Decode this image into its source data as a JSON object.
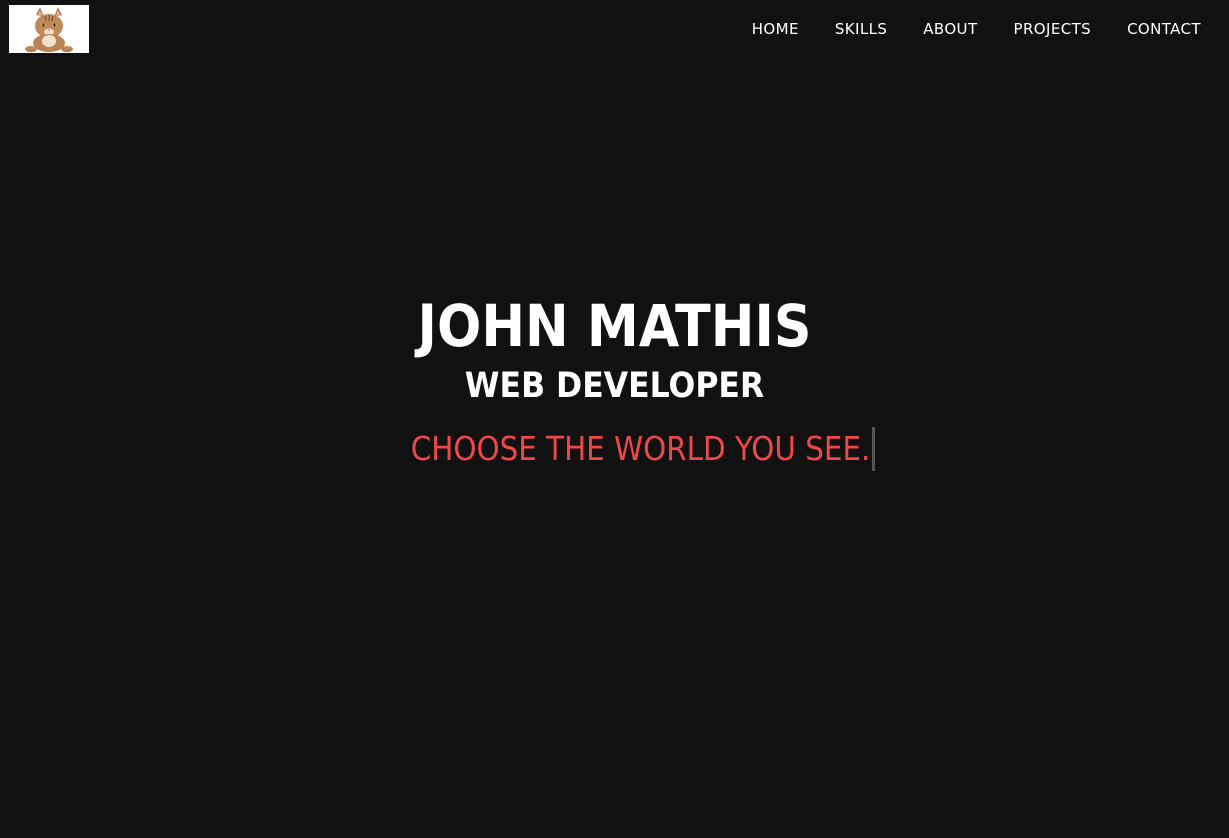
{
  "header": {
    "logo_icon": "cat-photo-logo",
    "nav": [
      {
        "label": "HOME"
      },
      {
        "label": "SKILLS"
      },
      {
        "label": "ABOUT"
      },
      {
        "label": "PROJECTS"
      },
      {
        "label": "CONTACT"
      }
    ]
  },
  "hero": {
    "name": "JOHN MATHIS",
    "role": "WEB DEVELOPER",
    "tagline": "CHOOSE THE WORLD YOU SEE."
  },
  "colors": {
    "background": "#111111",
    "text": "#ffffff",
    "accent": "#f0484a",
    "cursor": "#555555"
  }
}
